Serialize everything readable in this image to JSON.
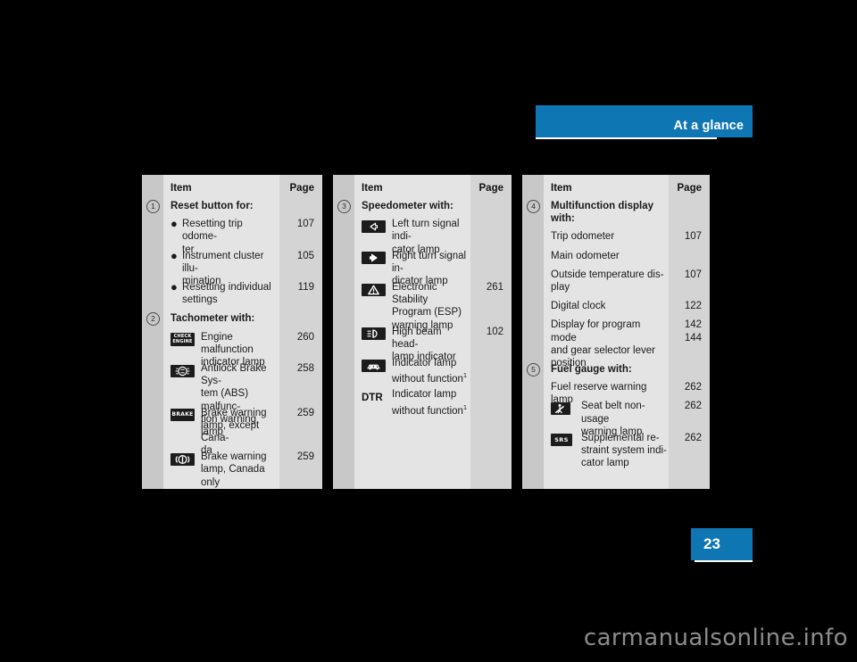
{
  "header": {
    "title": "At a glance"
  },
  "page_tab": {
    "number": "23"
  },
  "watermark": "carmanualsonline.info",
  "columns": [
    {
      "name": "column-1",
      "header": {
        "item": "Item",
        "page": "Page"
      },
      "groups": [
        {
          "marker": "1",
          "title": "Reset button for:",
          "rows": [
            {
              "kind": "bullet",
              "bullet": "●",
              "label": "Resetting trip odome-\nter",
              "page": "107"
            },
            {
              "kind": "bullet",
              "bullet": "●",
              "label": "Instrument cluster illu-\nmination",
              "page": "105"
            },
            {
              "kind": "bullet",
              "bullet": "●",
              "label": "Resetting individual\nsettings",
              "page": "119"
            }
          ]
        },
        {
          "marker": "2",
          "title": "Tachometer with:",
          "rows": [
            {
              "kind": "icon",
              "icon": "check-engine-icon",
              "label": "Engine malfunction\nindicator lamp",
              "page": "260"
            },
            {
              "kind": "icon",
              "icon": "abs-icon",
              "label": "Antilock Brake Sys-\ntem (ABS) malfunc-\ntion warning lamp",
              "page": "258"
            },
            {
              "kind": "icon",
              "icon": "brake-icon",
              "label": "Brake warning\nlamp, except Cana-\nda",
              "page": "259"
            },
            {
              "kind": "icon",
              "icon": "brake-canada-icon",
              "label": "Brake warning\nlamp, Canada only",
              "page": "259"
            }
          ]
        }
      ]
    },
    {
      "name": "column-2",
      "header": {
        "item": "Item",
        "page": "Page"
      },
      "groups": [
        {
          "marker": "3",
          "title": "Speedometer with:",
          "rows": [
            {
              "kind": "icon",
              "icon": "left-turn-signal-icon",
              "label": "Left turn signal indi-\ncator lamp",
              "page": ""
            },
            {
              "kind": "icon",
              "icon": "right-turn-signal-icon",
              "label": "Right turn signal in-\ndicator lamp",
              "page": ""
            },
            {
              "kind": "icon",
              "icon": "esp-warning-icon",
              "label": "Electronic Stability\nProgram (ESP)\nwarning lamp",
              "page": "261"
            },
            {
              "kind": "icon",
              "icon": "high-beam-icon",
              "label": "High beam head-\nlamp indicator",
              "page": "102"
            },
            {
              "kind": "icon",
              "icon": "car-indicator-icon",
              "label": "Indicator lamp\nwithout function",
              "footnote": "1",
              "page": ""
            },
            {
              "kind": "text-icon",
              "icon": "dtr-text-icon",
              "icon_text": "DTR",
              "label": "Indicator lamp\nwithout function",
              "footnote": "1",
              "page": ""
            }
          ]
        }
      ]
    },
    {
      "name": "column-3",
      "header": {
        "item": "Item",
        "page": "Page"
      },
      "groups": [
        {
          "marker": "4",
          "title": "Multifunction display\nwith:",
          "rows": [
            {
              "kind": "plain",
              "label": "Trip odometer",
              "page": "107"
            },
            {
              "kind": "plain",
              "label": "Main odometer",
              "page": ""
            },
            {
              "kind": "plain",
              "label": "Outside temperature dis-\nplay",
              "page": "107"
            },
            {
              "kind": "plain",
              "label": "Digital clock",
              "page": "122"
            },
            {
              "kind": "plain",
              "label": "Display for program mode\nand gear selector lever\nposition",
              "page": "142\n144"
            }
          ]
        },
        {
          "marker": "5",
          "title": "Fuel gauge with:",
          "rows": [
            {
              "kind": "plain",
              "label": "Fuel reserve warning lamp",
              "page": "262"
            },
            {
              "kind": "icon",
              "icon": "seat-belt-icon",
              "label": "Seat belt non-usage\nwarning lamp",
              "page": "262"
            },
            {
              "kind": "icon",
              "icon": "srs-icon",
              "label": "Supplemental re-\nstraint system indi-\ncator lamp",
              "page": "262"
            }
          ]
        }
      ]
    }
  ],
  "icon_labels": {
    "check_engine_line1": "CHECK",
    "check_engine_line2": "ENGINE",
    "brake": "BRAKE",
    "srs": "SRS",
    "dtr": "DTR"
  },
  "colors": {
    "accent": "#0f76b4",
    "page_background": "#000000",
    "table_body": "#e4e4e4",
    "table_page_col": "#d4d4d4",
    "table_num_col": "#c8c8c8",
    "icon_badge": "#1c1c1c"
  }
}
